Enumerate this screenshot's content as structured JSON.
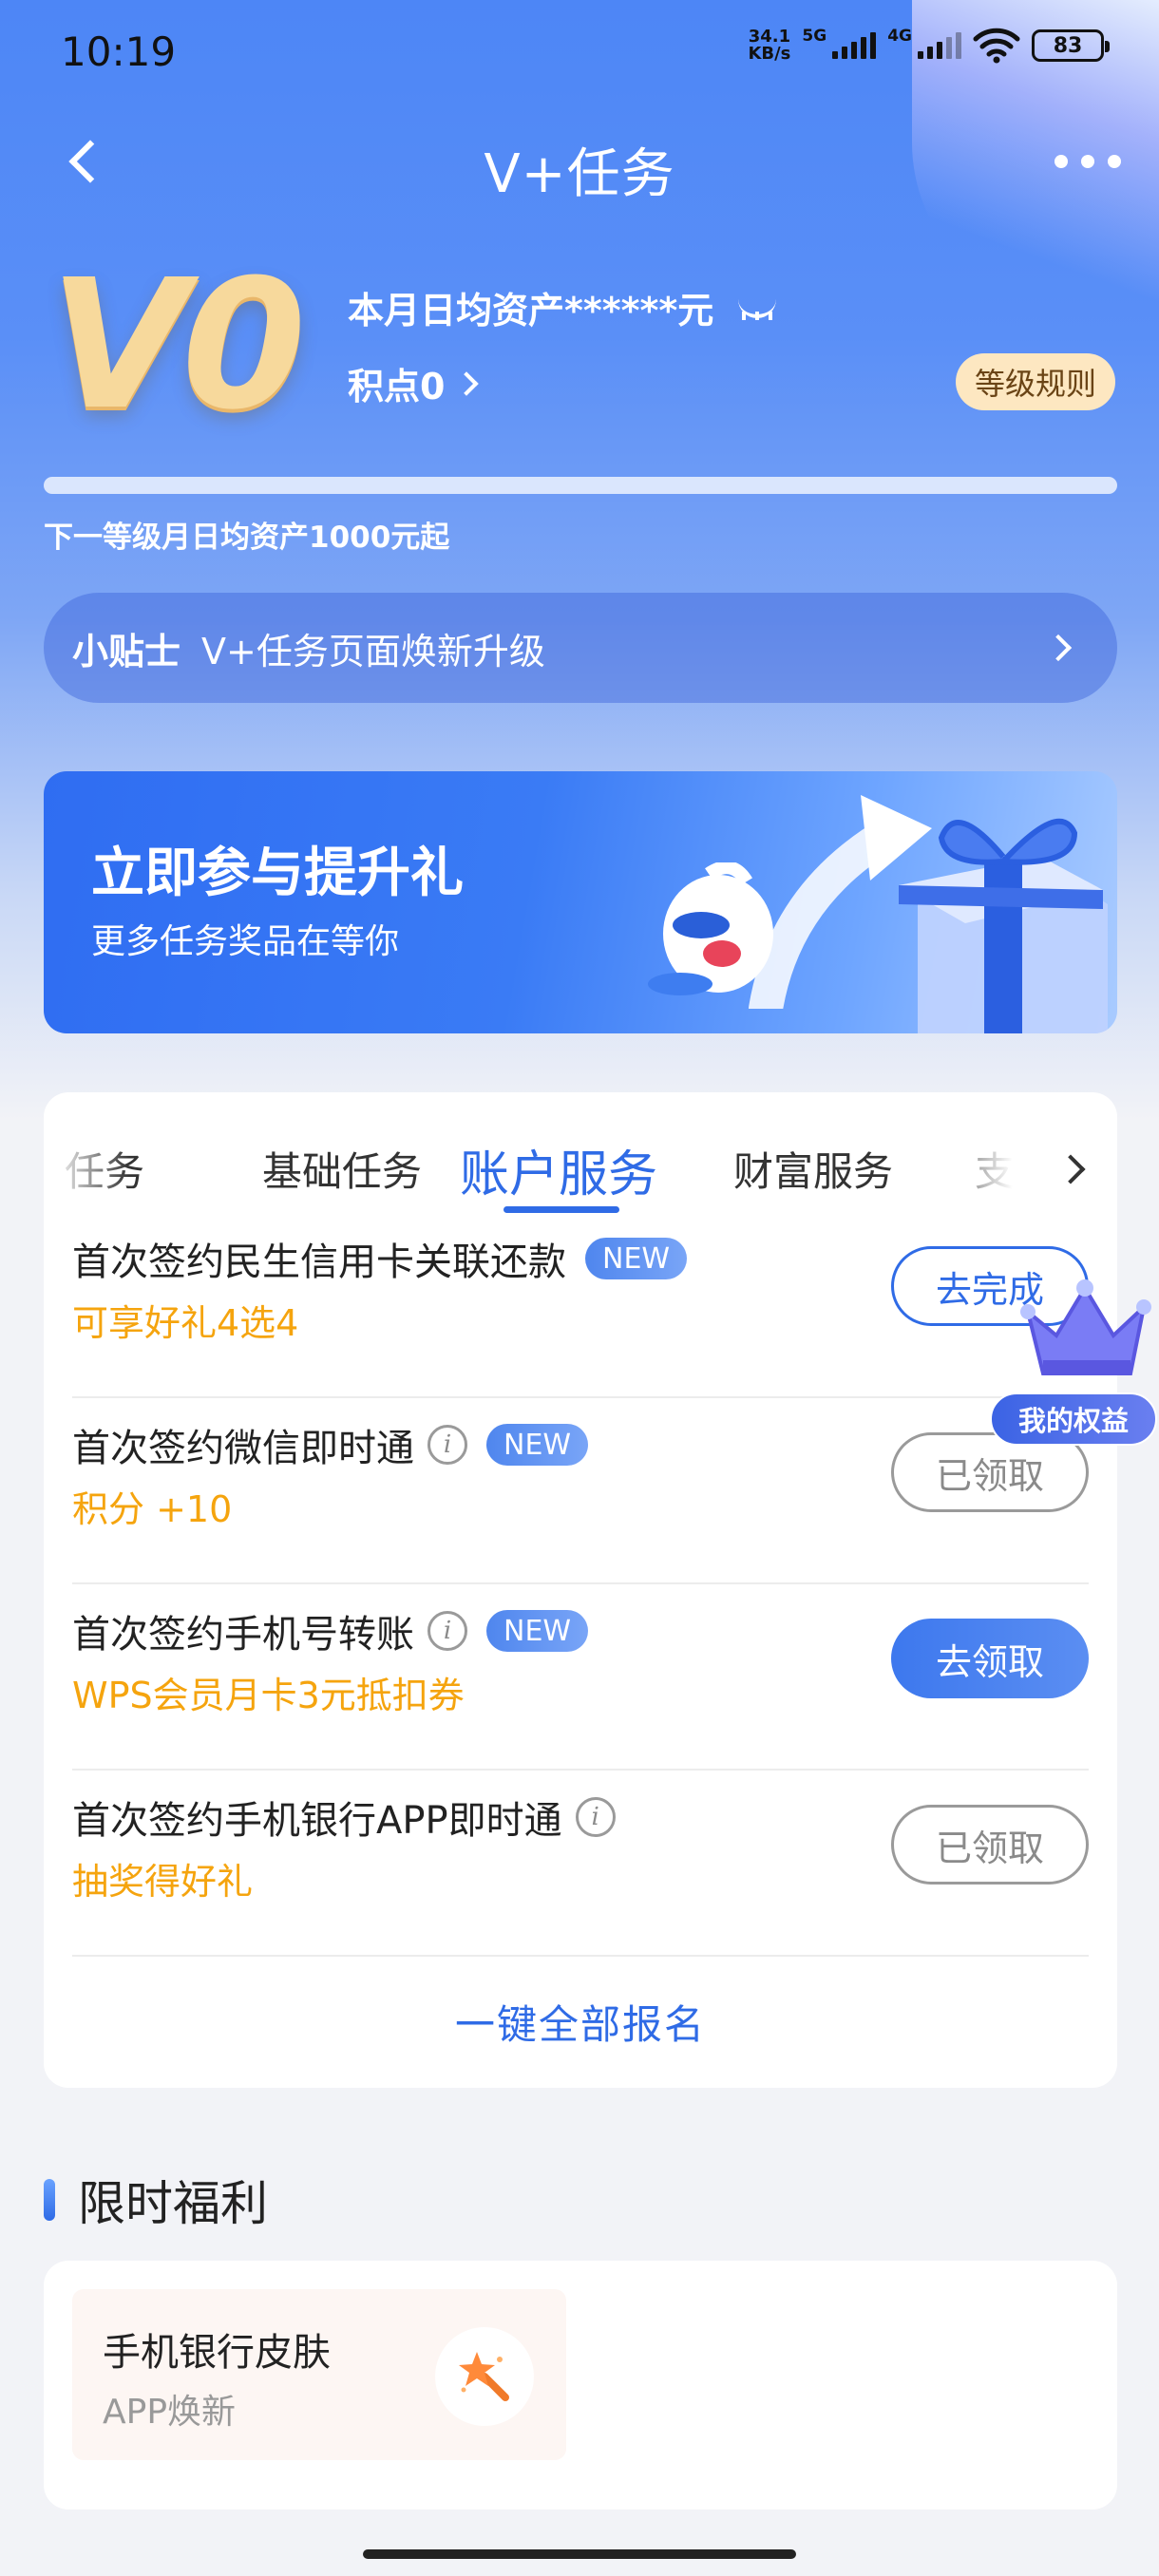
{
  "status_bar": {
    "time": "10:19",
    "net_speed_value": "34.1",
    "net_speed_unit": "KB/s",
    "gen_1": "5G",
    "gen_2": "4G",
    "battery": "83"
  },
  "nav": {
    "title": "V+任务"
  },
  "level": {
    "badge": "V0",
    "assets_text": "本月日均资产******元",
    "points_text": "积点0",
    "rules_button": "等级规则",
    "progress": 0,
    "next_level_text": "下一等级月日均资产1000元起"
  },
  "tip": {
    "label": "小贴士",
    "text": "V+任务页面焕新升级"
  },
  "promo": {
    "title": "立即参与提升礼",
    "subtitle": "更多任务奖品在等你"
  },
  "tabs": {
    "items": [
      "任务",
      "基础任务",
      "账户服务",
      "财富服务",
      "支"
    ],
    "active_index": 2
  },
  "tasks": [
    {
      "title": "首次签约民生信用卡关联还款",
      "info": false,
      "badge": "NEW",
      "reward": "可享好礼4选4",
      "button": "去完成",
      "button_style": "outline-blue"
    },
    {
      "title": "首次签约微信即时通",
      "info": true,
      "badge": "NEW",
      "reward": "积分 +10",
      "button": "已领取",
      "button_style": "outline-gray"
    },
    {
      "title": "首次签约手机号转账",
      "info": true,
      "badge": "NEW",
      "reward": "WPS会员月卡3元抵扣券",
      "button": "去领取",
      "button_style": "filled"
    },
    {
      "title": "首次签约手机银行APP即时通",
      "info": true,
      "badge": "",
      "reward": "抽奖得好礼",
      "button": "已领取",
      "button_style": "outline-gray"
    }
  ],
  "enroll_all": "一键全部报名",
  "benefits_float": "我的权益",
  "limited": {
    "title": "限时福利",
    "item_title": "手机银行皮肤",
    "item_sub": "APP焕新"
  },
  "colors": {
    "accent": "#2f6be6",
    "reward": "#f5a40e",
    "rules_bg": "#fde7c1"
  }
}
